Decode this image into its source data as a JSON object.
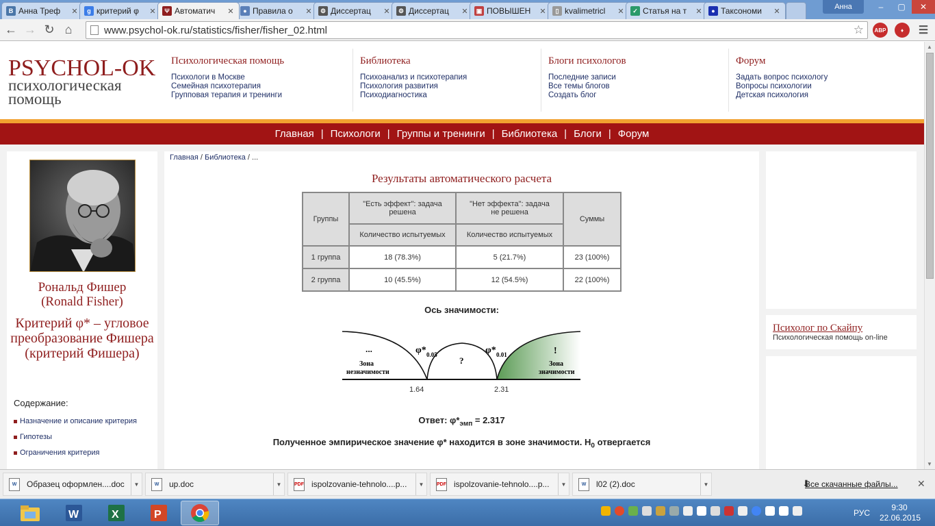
{
  "browser": {
    "tabs": [
      {
        "label": "Анна Треф",
        "color": "#4a76a8",
        "glyph": "В"
      },
      {
        "label": "критерий φ",
        "color": "#3b7de8",
        "glyph": "g"
      },
      {
        "label": "Автоматич",
        "color": "#8f1e1e",
        "glyph": "Ψ",
        "active": true
      },
      {
        "label": "Правила о",
        "color": "#5a7fb8",
        "glyph": "●"
      },
      {
        "label": "Диссертац",
        "color": "#555555",
        "glyph": "⚙"
      },
      {
        "label": "Диссертац",
        "color": "#555555",
        "glyph": "⚙"
      },
      {
        "label": "ПОВЫШЕН",
        "color": "#c04040",
        "glyph": "▣"
      },
      {
        "label": "kvalimetricl",
        "color": "#999999",
        "glyph": "▯"
      },
      {
        "label": "Статья на т",
        "color": "#2a9a6a",
        "glyph": "✓"
      },
      {
        "label": "Таксономи",
        "color": "#1a2fb0",
        "glyph": "●"
      }
    ],
    "user": "Анна",
    "url": "www.psychol-ok.ru/statistics/fisher/fisher_02.html",
    "ext_abp": "ABP",
    "win_min": "–",
    "win_max": "▢",
    "win_close": "✕"
  },
  "header": {
    "logo_top": "PSYCHOL-OK",
    "logo_bottom": "психологическая помощь",
    "cols": [
      {
        "title": "Психологическая помощь",
        "links": [
          "Психологи в Москве",
          "Семейная психотерапия",
          "Групповая терапия и тренинги"
        ]
      },
      {
        "title": "Библиотека",
        "links": [
          "Психоанализ и психотерапия",
          "Психология развития",
          "Психодиагностика"
        ]
      },
      {
        "title": "Блоги психологов",
        "links": [
          "Последние записи",
          "Все темы блогов",
          "Создать блог"
        ]
      },
      {
        "title": "Форум",
        "links": [
          "Задать вопрос психологу",
          "Вопросы психологии",
          "Детская психология"
        ]
      }
    ]
  },
  "menu": [
    "Главная",
    "Психологи",
    "Группы и тренинги",
    "Библиотека",
    "Блоги",
    "Форум"
  ],
  "left": {
    "name_ru": "Рональд Фишер",
    "name_en": "(Ronald Fisher)",
    "criterion": "Критерий φ* – угловое преобразование Фишера (критерий Фишера)",
    "toc_title": "Содержание:",
    "toc": [
      "Назначение и описание критерия",
      "Гипотезы",
      "Ограничения критерия"
    ]
  },
  "breadcrumb": {
    "home": "Главная",
    "sep1": " / ",
    "lib": "Библиотека",
    "sep2": " / ",
    "rest": "..."
  },
  "results": {
    "title": "Результаты автоматического расчета",
    "col_groups": "Группы",
    "col_effect": "\"Есть эффект\": задача решена",
    "col_noeffect": "\"Нет эффекта\": задача не решена",
    "col_sums": "Суммы",
    "sub_count": "Количество испытуемых",
    "rows": [
      {
        "group": "1 группа",
        "effect": "18 (78.3%)",
        "noeffect": "5 (21.7%)",
        "sum": "23 (100%)"
      },
      {
        "group": "2 группа",
        "effect": "10 (45.5%)",
        "noeffect": "12 (54.5%)",
        "sum": "22 (100%)"
      }
    ]
  },
  "axis": {
    "title": "Ось значимости:",
    "zone_left_dots": "...",
    "zone_left_1": "Зона",
    "zone_left_2": "незначимости",
    "phi": "φ*",
    "crit1_sub": "0.05",
    "crit2_sub": "0.01",
    "question": "?",
    "excl": "!",
    "zone_right_1": "Зона",
    "zone_right_2": "значимости",
    "v1": "1.64",
    "v2": "2.31"
  },
  "answer": {
    "prefix": "Ответ: φ*",
    "sub": "эмп",
    "value": " = 2.317"
  },
  "conclusion": {
    "text": "Полученное эмпирическое значение φ* находится в зоне значимости. H",
    "sub": "0",
    "tail": " отвергается"
  },
  "right": {
    "skype_title": "Психолог по Скайпу",
    "skype_sub": "Психологическая помощь on-line"
  },
  "downloads": [
    {
      "name": "Образец оформлен....doc",
      "type": "W"
    },
    {
      "name": "up.doc",
      "type": "W"
    },
    {
      "name": "ispolzovanie-tehnolo....p...",
      "type": "PDF"
    },
    {
      "name": "ispolzovanie-tehnolo....p...",
      "type": "PDF"
    },
    {
      "name": "l02 (2).doc",
      "type": "W"
    }
  ],
  "downloads_all": "Все скачанные файлы...",
  "taskbar": {
    "lang": "РУС",
    "time": "9:30",
    "date": "22.06.2015"
  }
}
